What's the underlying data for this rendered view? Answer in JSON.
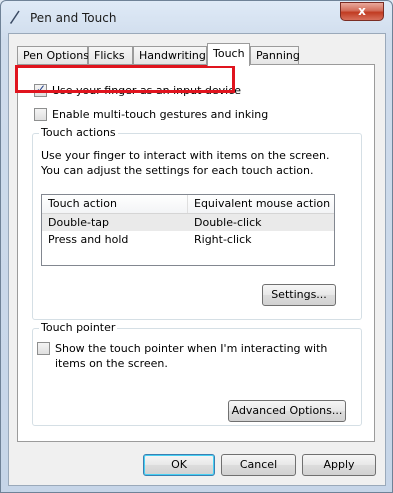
{
  "window": {
    "title": "Pen and Touch",
    "close_glyph": "x"
  },
  "tabs": [
    {
      "label": "Pen Options",
      "active": false
    },
    {
      "label": "Flicks",
      "active": false
    },
    {
      "label": "Handwriting",
      "active": false
    },
    {
      "label": "Touch",
      "active": true
    },
    {
      "label": "Panning",
      "active": false
    }
  ],
  "touch": {
    "use_finger": {
      "label": "Use your finger as an input device",
      "checked": true
    },
    "multi_touch": {
      "label": "Enable multi-touch gestures and inking",
      "checked": false
    },
    "actions": {
      "title": "Touch actions",
      "description": "Use your finger to interact with items on the screen. You can adjust the settings for each touch action.",
      "columns": [
        "Touch action",
        "Equivalent mouse action"
      ],
      "rows": [
        [
          "Double-tap",
          "Double-click"
        ],
        [
          "Press and hold",
          "Right-click"
        ]
      ],
      "settings_button": "Settings..."
    },
    "pointer": {
      "title": "Touch pointer",
      "show_pointer": {
        "label": "Show the touch pointer when I'm interacting with items on the screen.",
        "checked": false
      },
      "advanced_button": "Advanced Options..."
    }
  },
  "footer": {
    "ok": "OK",
    "cancel": "Cancel",
    "apply": "Apply"
  },
  "colors": {
    "highlight": "#e0141e",
    "close": "#c13b22"
  }
}
